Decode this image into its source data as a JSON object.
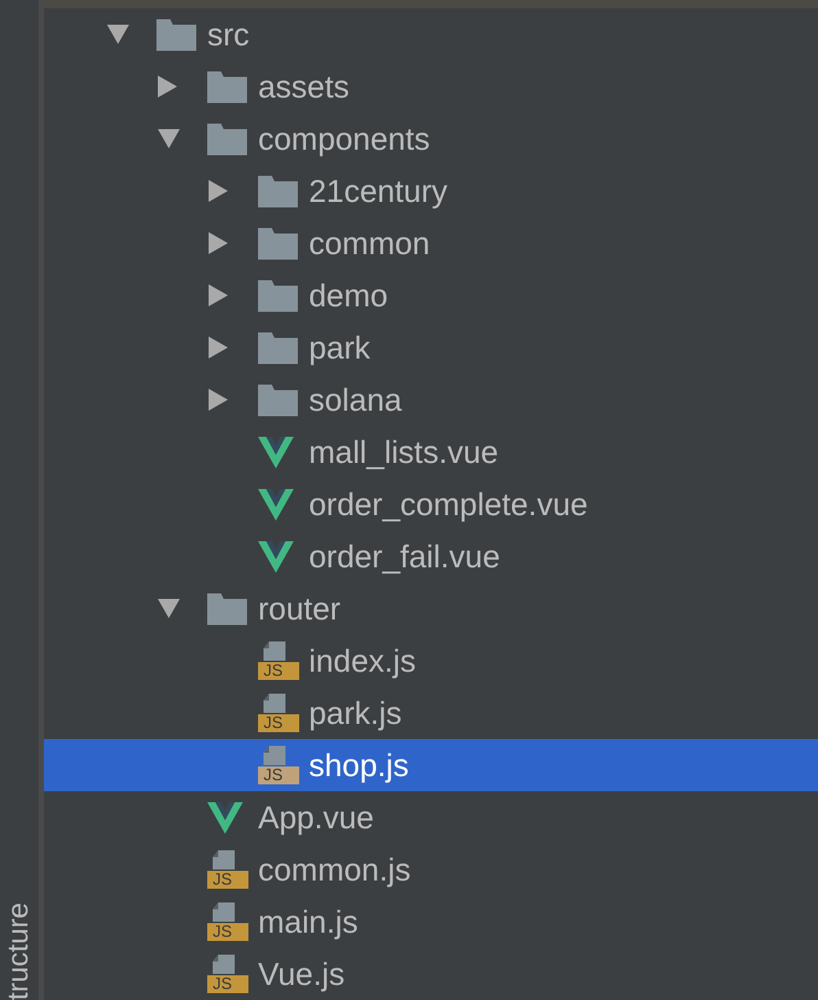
{
  "side_tab": {
    "label": "tructure"
  },
  "tree": [
    {
      "kind": "folder",
      "name": "src",
      "expanded": true,
      "selected": false,
      "children": [
        {
          "kind": "folder",
          "name": "assets",
          "expanded": false,
          "selected": false
        },
        {
          "kind": "folder",
          "name": "components",
          "expanded": true,
          "selected": false,
          "children": [
            {
              "kind": "folder",
              "name": "21century",
              "expanded": false,
              "selected": false
            },
            {
              "kind": "folder",
              "name": "common",
              "expanded": false,
              "selected": false
            },
            {
              "kind": "folder",
              "name": "demo",
              "expanded": false,
              "selected": false
            },
            {
              "kind": "folder",
              "name": "park",
              "expanded": false,
              "selected": false
            },
            {
              "kind": "folder",
              "name": "solana",
              "expanded": false,
              "selected": false
            },
            {
              "kind": "vue",
              "name": "mall_lists.vue",
              "selected": false
            },
            {
              "kind": "vue",
              "name": "order_complete.vue",
              "selected": false
            },
            {
              "kind": "vue",
              "name": "order_fail.vue",
              "selected": false
            }
          ]
        },
        {
          "kind": "folder",
          "name": "router",
          "expanded": true,
          "selected": false,
          "children": [
            {
              "kind": "js",
              "name": "index.js",
              "badge": "JS",
              "selected": false
            },
            {
              "kind": "js",
              "name": "park.js",
              "badge": "JS",
              "selected": false
            },
            {
              "kind": "js",
              "name": "shop.js",
              "badge": "JS",
              "selected": true
            }
          ]
        },
        {
          "kind": "vue",
          "name": "App.vue",
          "selected": false
        },
        {
          "kind": "js",
          "name": "common.js",
          "badge": "JS",
          "selected": false
        },
        {
          "kind": "js",
          "name": "main.js",
          "badge": "JS",
          "selected": false
        },
        {
          "kind": "js",
          "name": "Vue.js",
          "badge": "JS",
          "selected": false
        }
      ]
    }
  ]
}
